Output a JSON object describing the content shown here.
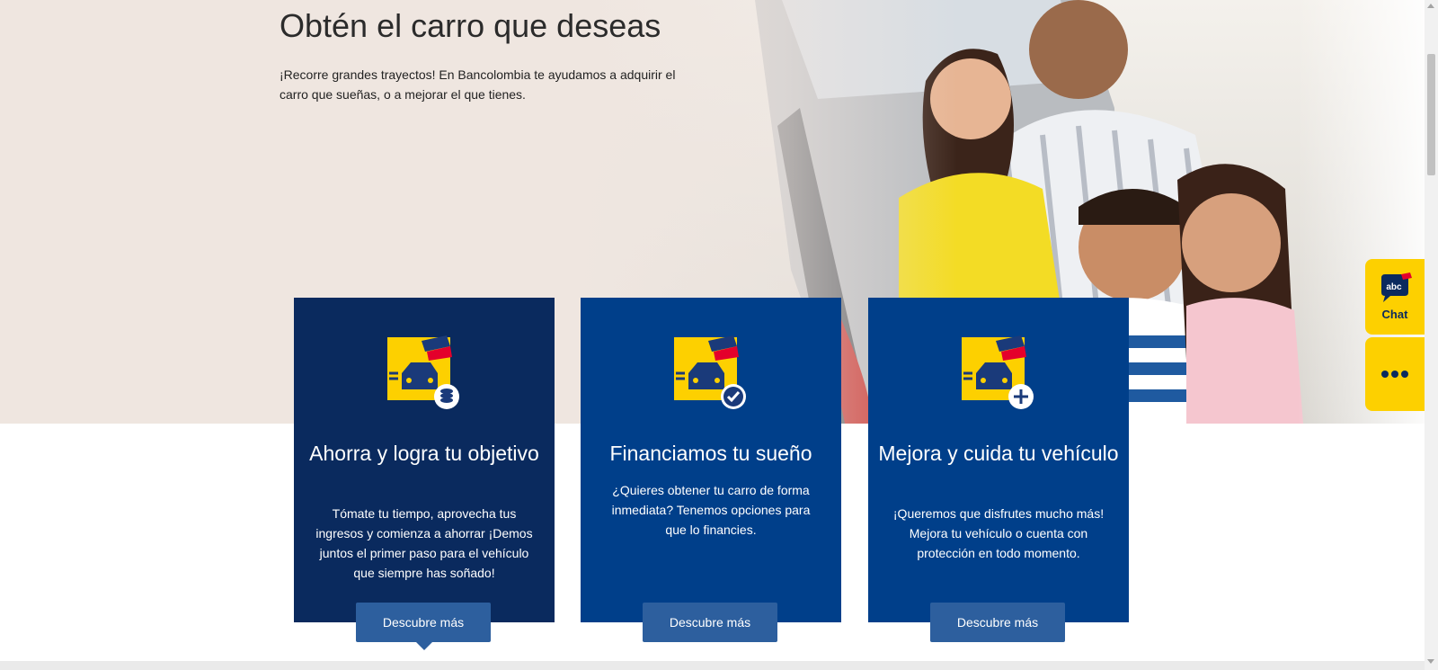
{
  "hero": {
    "title": "Obtén el carro que deseas",
    "description": "¡Recorre grandes trayectos! En Bancolombia te ayudamos a adquirir el carro que sueñas, o a mejorar el que tienes."
  },
  "cards": [
    {
      "icon": "car-savings-icon",
      "title": "Ahorra y logra tu objetivo",
      "text": "Tómate tu tiempo, aprovecha tus ingresos y comienza a ahorrar ¡Demos juntos el primer paso para el vehículo que siempre has soñado!",
      "button": "Descubre más"
    },
    {
      "icon": "car-financing-icon",
      "title": "Financiamos tu sueño",
      "text": "¿Quieres obtener tu carro de forma inmediata? Tenemos opciones para que lo financies.",
      "button": "Descubre más"
    },
    {
      "icon": "car-improve-icon",
      "title": "Mejora y cuida tu vehículo",
      "text": "¡Queremos que disfrutes mucho más! Mejora tu vehículo o cuenta con protección en todo momento.",
      "button": "Descubre más"
    }
  ],
  "side_widgets": {
    "chat_badge": "abc",
    "chat_label": "Chat",
    "more_icon": "more-dots-icon"
  },
  "colors": {
    "hero_bg": "#efe6e0",
    "card_dark": "#0a2a5e",
    "card_blue": "#003f8a",
    "button": "#2d5f9e",
    "brand_yellow": "#fdd000",
    "brand_red": "#e4002b"
  }
}
